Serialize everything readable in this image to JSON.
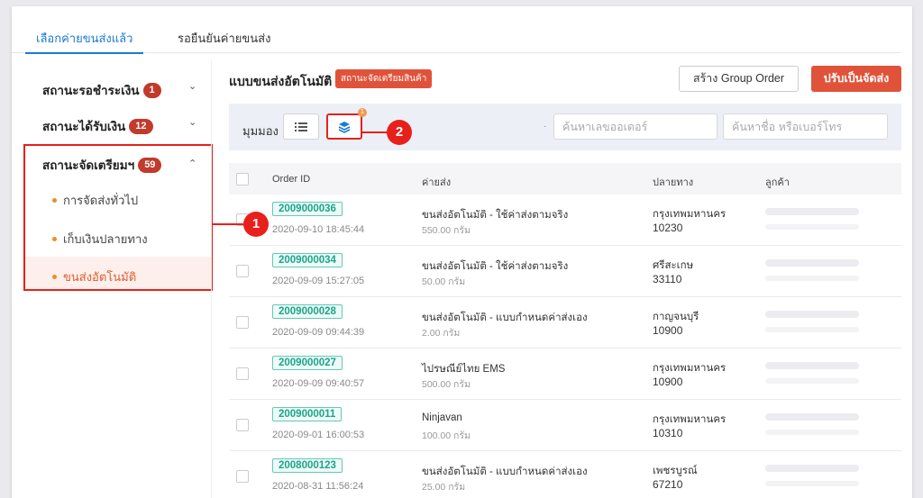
{
  "tabs": [
    {
      "label": "เลือกค่ายขนส่งแล้ว"
    },
    {
      "label": "รอยืนยันค่ายขนส่ง"
    }
  ],
  "sidebar": {
    "groups": [
      {
        "label": "สถานะรอชำระเงิน",
        "count": "1"
      },
      {
        "label": "สถานะได้รับเงิน",
        "count": "12"
      },
      {
        "label": "สถานะจัดเตรียมฯ",
        "count": "59"
      }
    ],
    "subitems": [
      {
        "label": "การจัดส่งทั่วไป"
      },
      {
        "label": "เก็บเงินปลายทาง"
      },
      {
        "label": "ขนส่งอัตโนมัติ"
      }
    ]
  },
  "header": {
    "title": "แบบขนส่งอัตโนมัติ",
    "status_tag": "สถานะจัดเตรียมสินค้า",
    "group_order_button": "สร้าง Group Order",
    "ship_button": "ปรับเป็นจัดส่ง"
  },
  "toolbar": {
    "view_label": "มุมมอง",
    "notif_count": "1",
    "order_search_placeholder": "ค้นหาเลขออเดอร์",
    "customer_search_placeholder": "ค้นหาชื่อ หรือเบอร์โทร"
  },
  "callouts": {
    "one": "1",
    "two": "2"
  },
  "table": {
    "columns": [
      "Order ID",
      "ค่ายส่ง",
      "ปลายทาง",
      "ลูกค้า"
    ],
    "rows": [
      {
        "order_id": "2009000036",
        "date": "2020-09-10 18:45:44",
        "ship": "ขนส่งอัตโนมัติ - ใช้ค่าส่งตามจริง",
        "weight": "550.00 กรัม",
        "dest": "กรุงเทพมหานคร",
        "zip": "10230"
      },
      {
        "order_id": "2009000034",
        "date": "2020-09-09 15:27:05",
        "ship": "ขนส่งอัตโนมัติ - ใช้ค่าส่งตามจริง",
        "weight": "50.00 กรัม",
        "dest": "ศรีสะเกษ",
        "zip": "33110"
      },
      {
        "order_id": "2009000028",
        "date": "2020-09-09 09:44:39",
        "ship": "ขนส่งอัตโนมัติ - แบบกำหนดค่าส่งเอง",
        "weight": "2.00 กรัม",
        "dest": "กาญจนบุรี",
        "zip": "10900"
      },
      {
        "order_id": "2009000027",
        "date": "2020-09-09 09:40:57",
        "ship": "ไปรษณีย์ไทย EMS",
        "weight": "500.00 กรัม",
        "dest": "กรุงเทพมหานคร",
        "zip": "10900"
      },
      {
        "order_id": "2009000011",
        "date": "2020-09-01 16:00:53",
        "ship": "Ninjavan",
        "weight": "100.00 กรัม",
        "dest": "กรุงเทพมหานคร",
        "zip": "10310"
      },
      {
        "order_id": "2008000123",
        "date": "2020-08-31 11:56:24",
        "ship": "ขนส่งอัตโนมัติ - แบบกำหนดค่าส่งเอง",
        "weight": "25.00 กรัม",
        "dest": "เพชรบูรณ์",
        "zip": "67210"
      }
    ]
  },
  "colors": {
    "accent": "#1a7ad6",
    "primary": "#e0533a",
    "badge": "#c23a2b",
    "order_id": "#19a68a",
    "callout": "#e8201b"
  }
}
